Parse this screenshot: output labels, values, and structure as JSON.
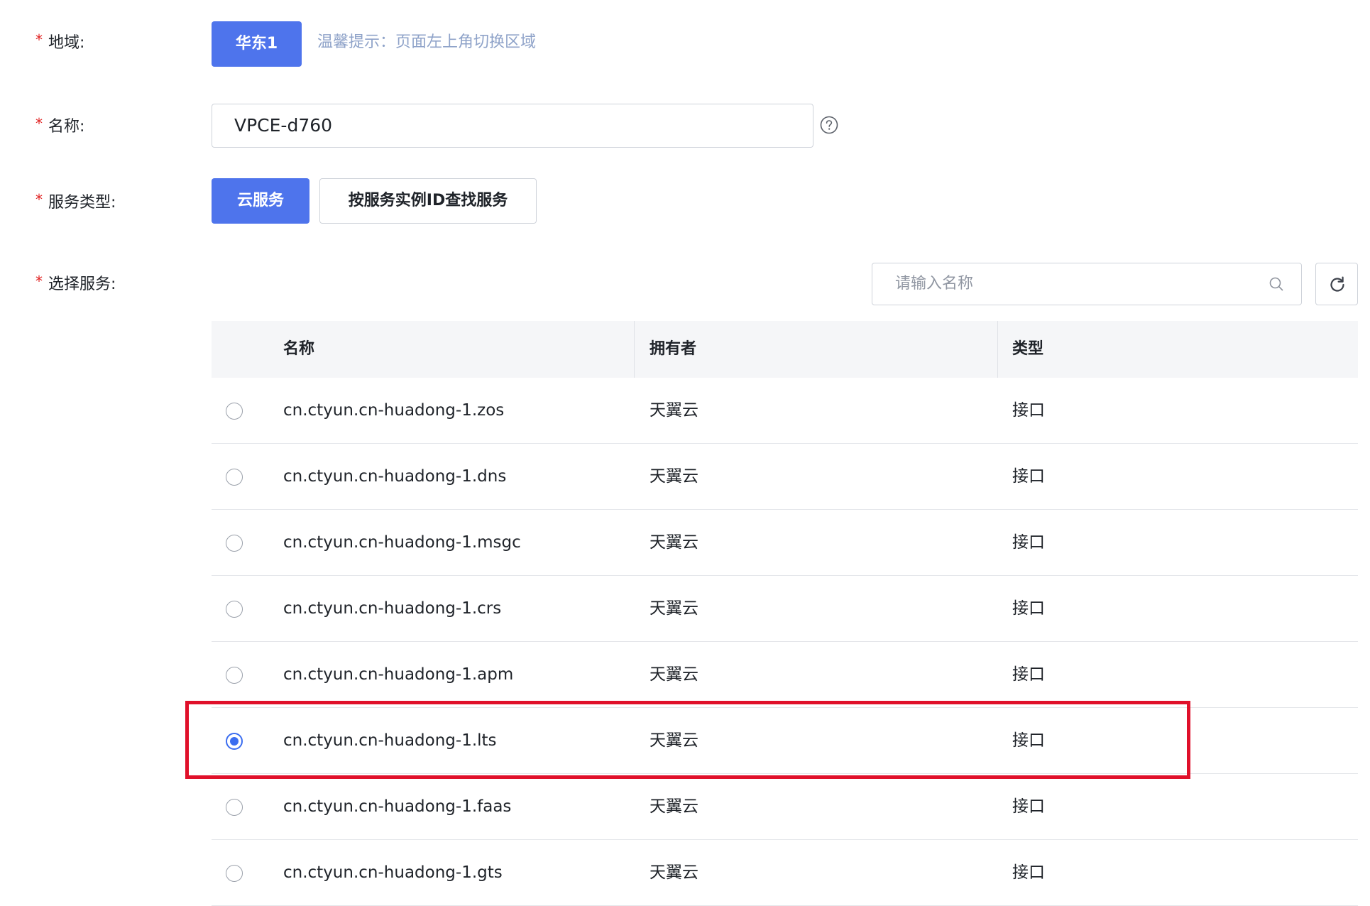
{
  "required_mark": "*",
  "region": {
    "label": "地域:",
    "button": "华东1",
    "hint": "温馨提示：页面左上角切换区域"
  },
  "name": {
    "label": "名称:",
    "value": "VPCE-d760",
    "help_icon": "question-circle-icon"
  },
  "service_type": {
    "label": "服务类型:",
    "options": [
      "云服务",
      "按服务实例ID查找服务"
    ],
    "selected": "云服务"
  },
  "select_service": {
    "label": "选择服务:",
    "search_placeholder": "请输入名称",
    "search_icon": "search-icon",
    "refresh_icon": "refresh-icon"
  },
  "table": {
    "columns": [
      "名称",
      "拥有者",
      "类型"
    ],
    "rows": [
      {
        "name": "cn.ctyun.cn-huadong-1.zos",
        "owner": "天翼云",
        "type": "接口",
        "selected": false
      },
      {
        "name": "cn.ctyun.cn-huadong-1.dns",
        "owner": "天翼云",
        "type": "接口",
        "selected": false
      },
      {
        "name": "cn.ctyun.cn-huadong-1.msgc",
        "owner": "天翼云",
        "type": "接口",
        "selected": false
      },
      {
        "name": "cn.ctyun.cn-huadong-1.crs",
        "owner": "天翼云",
        "type": "接口",
        "selected": false
      },
      {
        "name": "cn.ctyun.cn-huadong-1.apm",
        "owner": "天翼云",
        "type": "接口",
        "selected": false
      },
      {
        "name": "cn.ctyun.cn-huadong-1.lts",
        "owner": "天翼云",
        "type": "接口",
        "selected": true
      },
      {
        "name": "cn.ctyun.cn-huadong-1.faas",
        "owner": "天翼云",
        "type": "接口",
        "selected": false
      },
      {
        "name": "cn.ctyun.cn-huadong-1.gts",
        "owner": "天翼云",
        "type": "接口",
        "selected": false
      }
    ]
  },
  "colors": {
    "primary": "#4e74ec",
    "required": "#e02020",
    "hint": "#8fa3c9",
    "highlight": "#e0102a"
  }
}
